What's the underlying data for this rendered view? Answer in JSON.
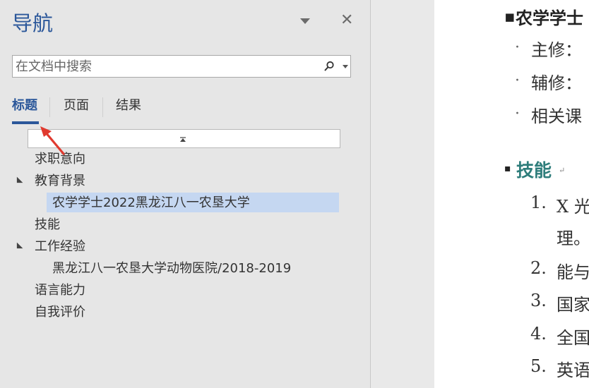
{
  "nav_pane": {
    "title": "导航",
    "search_placeholder": "在文档中搜索",
    "tabs": [
      "标题",
      "页面",
      "结果"
    ],
    "headings": [
      {
        "text": "求职意向",
        "level": 1,
        "expanded": null
      },
      {
        "text": "教育背景",
        "level": 1,
        "expanded": true
      },
      {
        "text": "农学学士2022黑龙江八一农垦大学",
        "level": 2,
        "selected": true
      },
      {
        "text": "技能",
        "level": 1,
        "expanded": null
      },
      {
        "text": "工作经验",
        "level": 1,
        "expanded": true
      },
      {
        "text": "黑龙江八一农垦大学动物医院/2018-2019",
        "level": 2
      },
      {
        "text": "语言能力",
        "level": 1
      },
      {
        "text": "自我评价",
        "level": 1
      }
    ]
  },
  "document": {
    "lines": [
      {
        "bullet": "▪",
        "text": "农学学士"
      },
      {
        "bullet": "·",
        "text": "主修："
      },
      {
        "bullet": "·",
        "text": "辅修："
      },
      {
        "bullet": "·",
        "text": "相关课"
      },
      {
        "bullet": "▪",
        "text": "技能",
        "mark": "↵"
      },
      {
        "num": "1.",
        "text": "X 光"
      },
      {
        "num": "",
        "text": "理。"
      },
      {
        "num": "2.",
        "text": "能与"
      },
      {
        "num": "3.",
        "text": "国家"
      },
      {
        "num": "4.",
        "text": "全国"
      },
      {
        "num": "5.",
        "text": "英语"
      }
    ]
  },
  "colors": {
    "accent": "#2b579a",
    "selection": "#c5d7f1",
    "skills_heading": "#2e7d7b",
    "arrow": "#e03a2f"
  }
}
